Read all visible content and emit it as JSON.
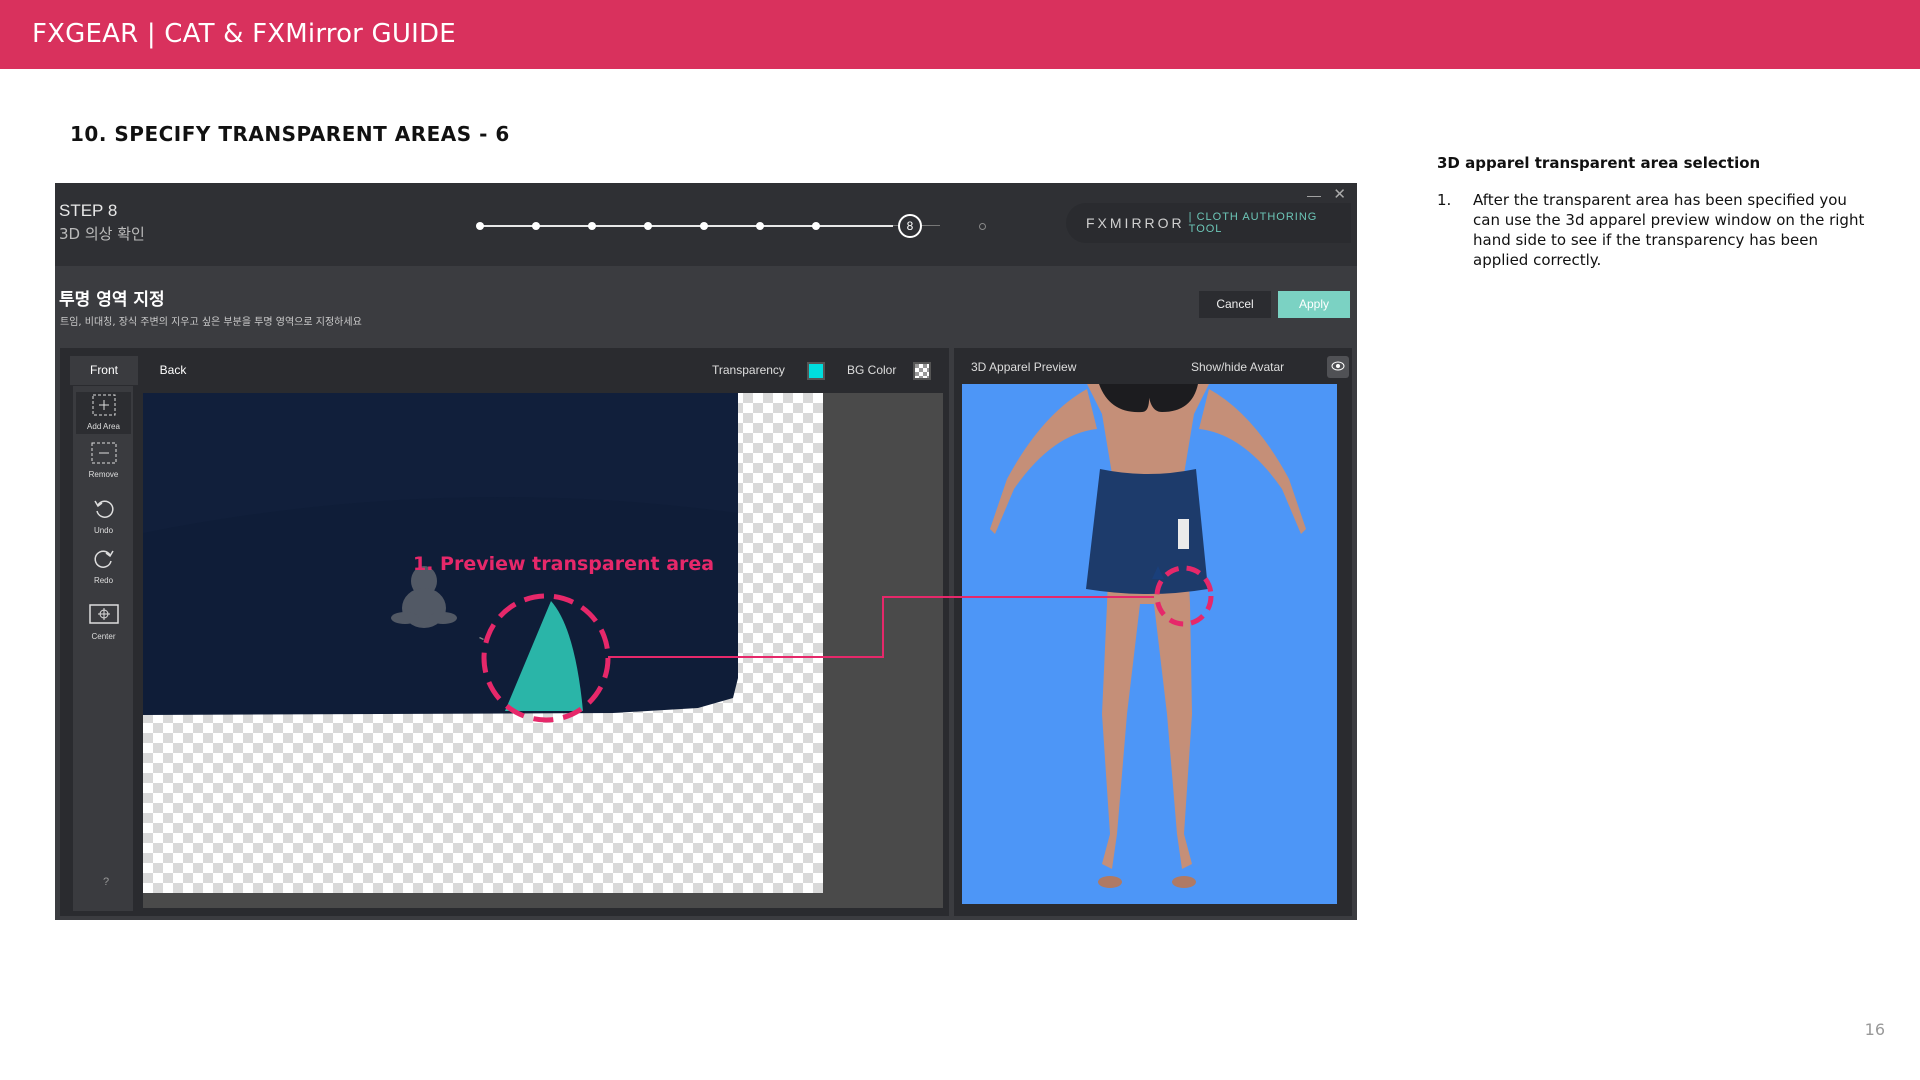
{
  "header": {
    "title": "FXGEAR | CAT & FXMirror GUIDE"
  },
  "section": {
    "title": "10. SPECIFY TRANSPARENT AREAS - 6"
  },
  "notes": {
    "heading": "3D apparel transparent area selection",
    "items": [
      {
        "num": "1.",
        "text": "After the transparent area has been specified you can use the 3d apparel preview window on the right hand side to see if the transparency has been applied correctly."
      }
    ]
  },
  "page_number": "16",
  "app": {
    "step_title": "STEP 8",
    "step_subtitle": "3D 의상 확인",
    "current_step": "8",
    "brand_name": "FXMIRROR",
    "brand_tag": "| CLOTH AUTHORING TOOL",
    "minimize_glyph": "—",
    "close_glyph": "✕",
    "area_title": "투명 영역 지정",
    "area_desc": "트임, 비대칭, 장식 주변의 지우고 싶은 부분을 투명 영역으로 지정하세요",
    "cancel_label": "Cancel",
    "apply_label": "Apply",
    "tabs": {
      "front": "Front",
      "back": "Back"
    },
    "options": {
      "transparency": "Transparency",
      "bg_color": "BG Color",
      "transparency_color": "#00dede"
    },
    "tools": [
      {
        "label": "Add Area",
        "icon": "add-area-icon"
      },
      {
        "label": "Remove",
        "icon": "remove-area-icon"
      },
      {
        "label": "Undo",
        "icon": "undo-icon"
      },
      {
        "label": "Redo",
        "icon": "redo-icon"
      },
      {
        "label": "Center",
        "icon": "center-icon"
      }
    ],
    "help_glyph": "?",
    "preview": {
      "label": "3D Apparel Preview",
      "avatar_toggle": "Show/hide Avatar"
    }
  },
  "callout": {
    "text": "1. Preview transparent area",
    "color": "#e6286a"
  },
  "colors": {
    "header": "#d9315d",
    "accent": "#7bd2c3",
    "preview_bg": "#4d96f7"
  }
}
